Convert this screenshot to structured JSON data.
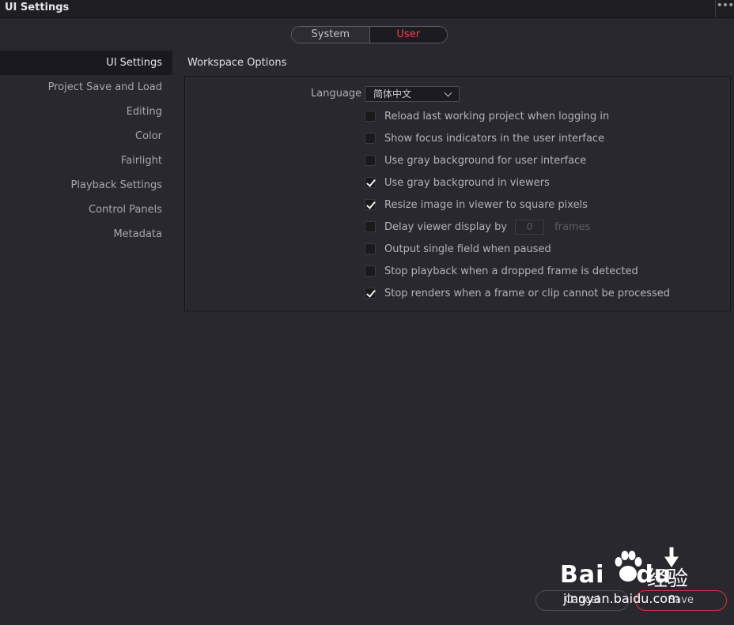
{
  "window": {
    "title": "UI Settings",
    "menu_icon": "ellipsis-icon"
  },
  "tabs": [
    {
      "label": "System",
      "active": false
    },
    {
      "label": "User",
      "active": true
    }
  ],
  "sidebar": {
    "items": [
      {
        "label": "UI Settings",
        "active": true
      },
      {
        "label": "Project Save and Load",
        "active": false
      },
      {
        "label": "Editing",
        "active": false
      },
      {
        "label": "Color",
        "active": false
      },
      {
        "label": "Fairlight",
        "active": false
      },
      {
        "label": "Playback Settings",
        "active": false
      },
      {
        "label": "Control Panels",
        "active": false
      },
      {
        "label": "Metadata",
        "active": false
      }
    ]
  },
  "workspace": {
    "title": "Workspace Options",
    "language_label": "Language",
    "language_value": "简体中文",
    "options": [
      {
        "label": "Reload last working project when logging in",
        "checked": false
      },
      {
        "label": "Show focus indicators in the user interface",
        "checked": false
      },
      {
        "label": "Use gray background for user interface",
        "checked": false
      },
      {
        "label": "Use gray background in viewers",
        "checked": true
      },
      {
        "label": "Resize image in viewer to square pixels",
        "checked": true
      },
      {
        "label": "Delay viewer display by",
        "checked": false,
        "input_value": "0",
        "unit": "frames"
      },
      {
        "label": "Output single field when paused",
        "checked": false
      },
      {
        "label": "Stop playback when a dropped frame is detected",
        "checked": false
      },
      {
        "label": "Stop renders when a frame or clip cannot be processed",
        "checked": true
      }
    ]
  },
  "footer": {
    "cancel_label": "Cancel",
    "save_label": "Save"
  },
  "watermark": {
    "brand": "Bai",
    "brand2": "du",
    "cjk": "经验",
    "sub": "jingyan.baidu.com"
  },
  "colors": {
    "accent": "#e0484f",
    "background": "#28282e"
  }
}
